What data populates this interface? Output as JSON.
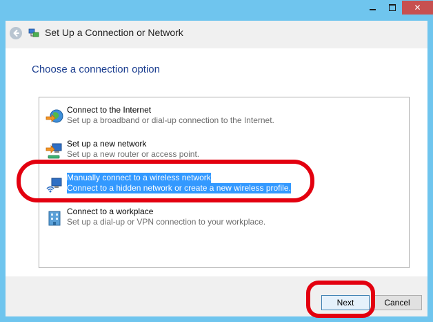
{
  "window": {
    "title": "Set Up a Connection or Network",
    "close_glyph": "✕"
  },
  "main": {
    "instruction": "Choose a connection option",
    "options": [
      {
        "title": "Connect to the Internet",
        "description": "Set up a broadband or dial-up connection to the Internet.",
        "icon": "globe-internet-icon",
        "selected": false
      },
      {
        "title": "Set up a new network",
        "description": "Set up a new router or access point.",
        "icon": "new-network-icon",
        "selected": false
      },
      {
        "title": "Manually connect to a wireless network",
        "description": "Connect to a hidden network or create a new wireless profile.",
        "icon": "wireless-network-icon",
        "selected": true
      },
      {
        "title": "Connect to a workplace",
        "description": "Set up a dial-up or VPN connection to your workplace.",
        "icon": "workplace-icon",
        "selected": false
      }
    ]
  },
  "footer": {
    "next_label": "Next",
    "cancel_label": "Cancel"
  },
  "colors": {
    "frame": "#6fc5ee",
    "selection": "#3399ff",
    "instruction_text": "#1a3d8f",
    "annotation": "#e3000f",
    "close_button": "#c75050"
  }
}
